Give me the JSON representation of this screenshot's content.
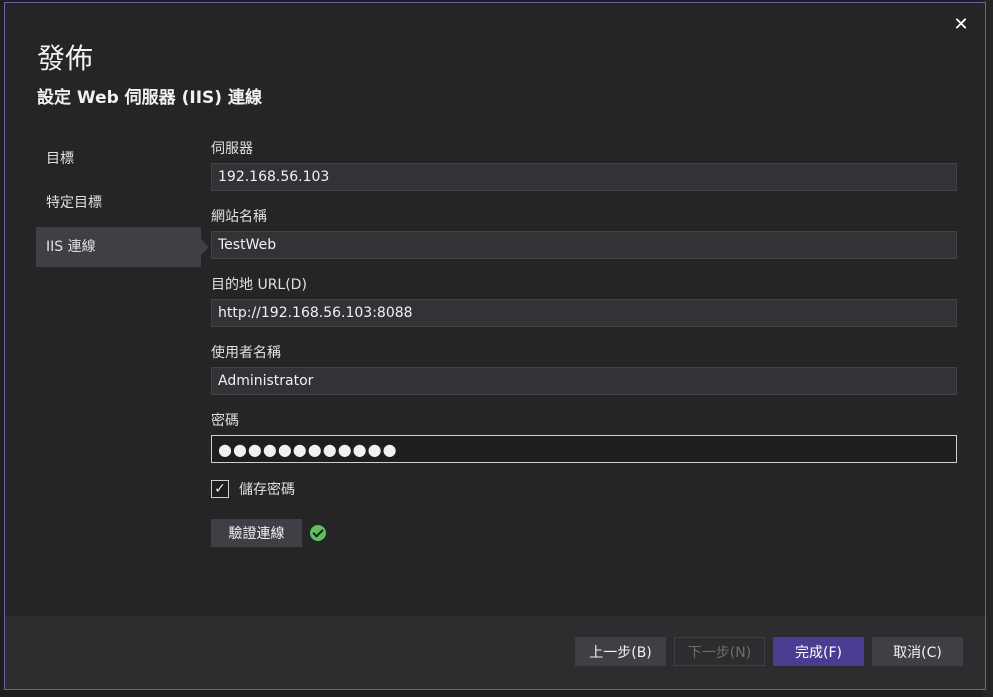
{
  "dialog": {
    "title": "發佈",
    "subtitle": "設定 Web 伺服器 (IIS) 連線",
    "close_glyph": "✕"
  },
  "nav": {
    "items": [
      {
        "label": "目標",
        "active": false
      },
      {
        "label": "特定目標",
        "active": false
      },
      {
        "label": "IIS 連線",
        "active": true
      }
    ]
  },
  "form": {
    "server": {
      "label": "伺服器",
      "value": "192.168.56.103"
    },
    "site_name": {
      "label": "網站名稱",
      "value": "TestWeb"
    },
    "destination_url": {
      "label": "目的地 URL(D)",
      "value": "http://192.168.56.103:8088"
    },
    "username": {
      "label": "使用者名稱",
      "value": "Administrator"
    },
    "password": {
      "label": "密碼",
      "value": "●●●●●●●●●●●●"
    },
    "save_password": {
      "label": "儲存密碼",
      "checked": true,
      "glyph": "✓"
    },
    "validate_label": "驗證連線",
    "validation_status": "success"
  },
  "footer": {
    "prev_label": "上一步(B)",
    "next_label": "下一步(N)",
    "finish_label": "完成(F)",
    "cancel_label": "取消(C)"
  },
  "colors": {
    "dialog_bg": "#252526",
    "dialog_border": "#6c5fa7",
    "input_bg": "#333337",
    "primary_button": "#4a3d91",
    "success": "#5fc05f"
  }
}
